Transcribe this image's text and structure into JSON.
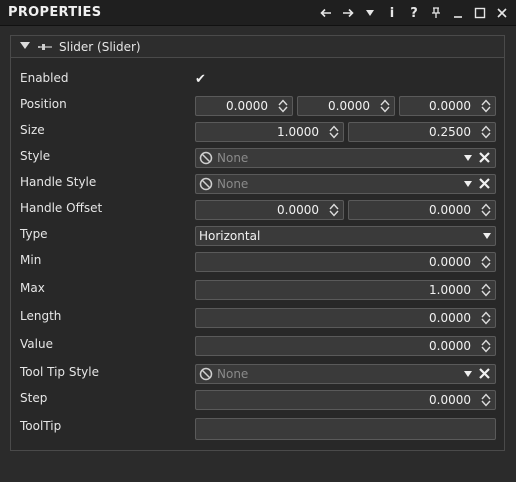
{
  "titlebar": {
    "title": "PROPERTIES",
    "icons": [
      "arrow-left-icon",
      "arrow-right-icon",
      "dropdown-icon",
      "info-icon",
      "help-icon",
      "pin-icon",
      "minimize-icon",
      "maximize-icon",
      "close-icon"
    ],
    "info_glyph": "i",
    "help_glyph": "?"
  },
  "section": {
    "title": "Slider (Slider)"
  },
  "props": {
    "enabled": {
      "label": "Enabled",
      "checked": true,
      "check_glyph": "✔"
    },
    "position": {
      "label": "Position",
      "x": "0.0000",
      "y": "0.0000",
      "z": "0.0000"
    },
    "size": {
      "label": "Size",
      "w": "1.0000",
      "h": "0.2500"
    },
    "style": {
      "label": "Style",
      "value": "None"
    },
    "handle_style": {
      "label": "Handle Style",
      "value": "None"
    },
    "handle_offset": {
      "label": "Handle Offset",
      "x": "0.0000",
      "y": "0.0000"
    },
    "type": {
      "label": "Type",
      "value": "Horizontal"
    },
    "min": {
      "label": "Min",
      "value": "0.0000"
    },
    "max": {
      "label": "Max",
      "value": "1.0000"
    },
    "length": {
      "label": "Length",
      "value": "0.0000"
    },
    "value": {
      "label": "Value",
      "value": "0.0000"
    },
    "tooltip_style": {
      "label": "Tool Tip Style",
      "value": "None"
    },
    "step": {
      "label": "Step",
      "value": "0.0000"
    },
    "tooltip": {
      "label": "ToolTip",
      "value": ""
    }
  }
}
